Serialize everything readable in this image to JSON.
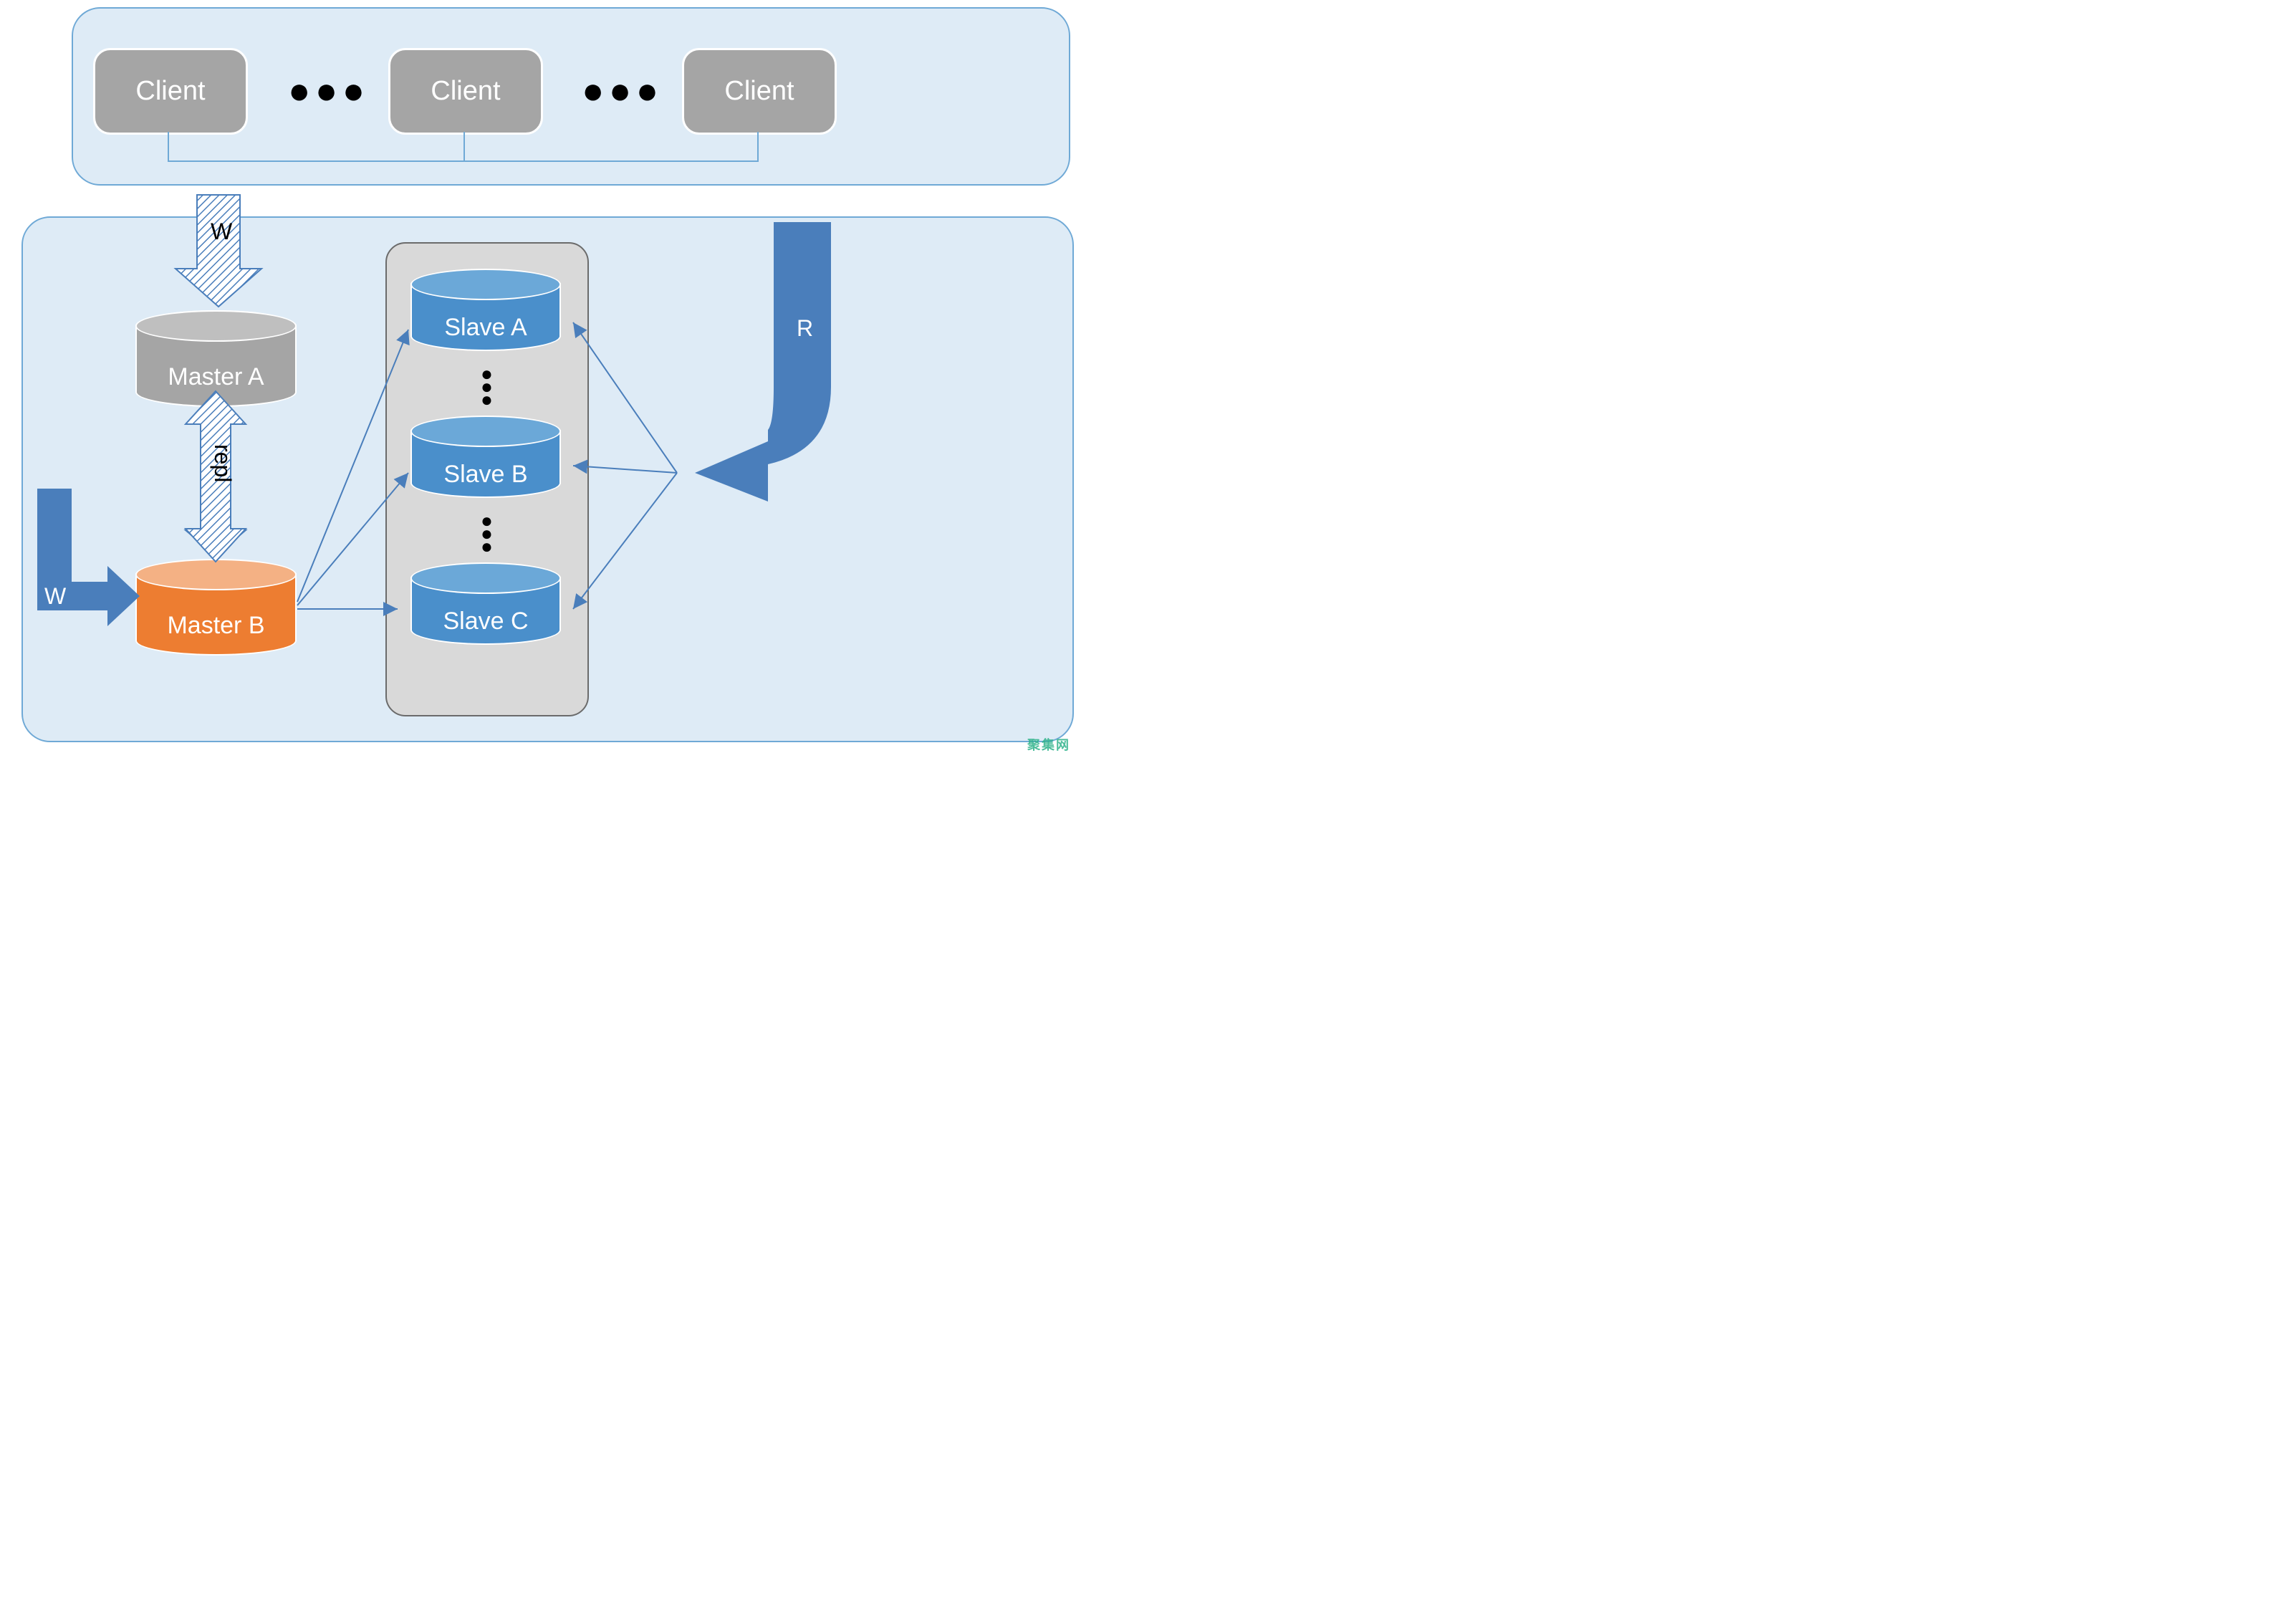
{
  "clients": {
    "labels": [
      "Client",
      "Client",
      "Client"
    ]
  },
  "masters": {
    "a": "Master A",
    "b": "Master B"
  },
  "slaves": {
    "a": "Slave A",
    "b": "Slave B",
    "c": "Slave C"
  },
  "arrows": {
    "write_top": "W",
    "write_left": "W",
    "repl": "repl",
    "read": "R"
  },
  "ellipsis": "● ● ●",
  "watermark": "聚集网",
  "colors": {
    "panel_bg": "#DEEBF6",
    "panel_border": "#6FA9D6",
    "client_grey": "#A5A5A5",
    "master_orange": "#ED7D31",
    "slave_blue": "#4A8FCB",
    "arrow_blue": "#4A7EBB"
  }
}
